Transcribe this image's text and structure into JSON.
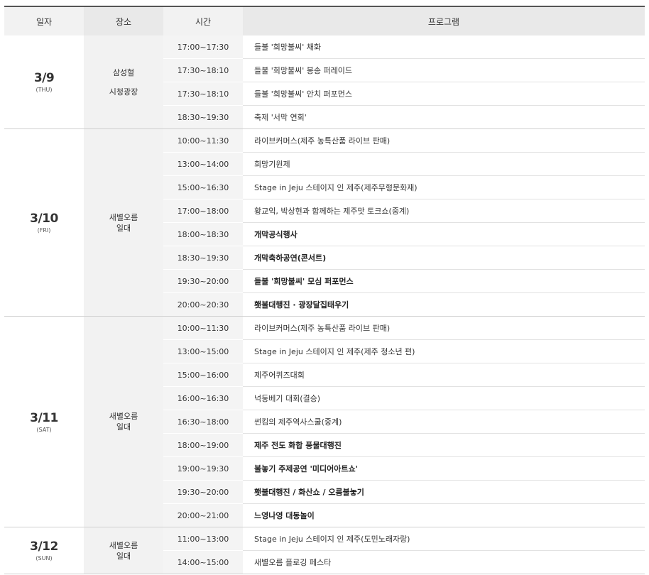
{
  "headers": {
    "date": "일자",
    "place": "장소",
    "time": "시간",
    "program": "프로그램"
  },
  "days": [
    {
      "date": "3/9",
      "weekday": "(THU)",
      "place_lines": [
        "삼성혈",
        "시청광장"
      ],
      "rows": [
        {
          "time": "17:00~17:30",
          "program": "들불 '희망불씨' 채화",
          "bold": false
        },
        {
          "time": "17:30~18:10",
          "program": "들불 '희망불씨' 봉송 퍼레이드",
          "bold": false
        },
        {
          "time": "17:30~18:10",
          "program": "들불 '희망불씨' 안치 퍼포먼스",
          "bold": false
        },
        {
          "time": "18:30~19:30",
          "program": "축제 '서막 연회'",
          "bold": false
        }
      ]
    },
    {
      "date": "3/10",
      "weekday": "(FRI)",
      "place_lines": [
        "새별오름",
        "일대"
      ],
      "rows": [
        {
          "time": "10:00~11:30",
          "program": "라이브커머스(제주 농특산품 라이브 판매)",
          "bold": false
        },
        {
          "time": "13:00~14:00",
          "program": "희망기원제",
          "bold": false
        },
        {
          "time": "15:00~16:30",
          "program": "Stage in Jeju 스테이지 인 제주(제주무형문화재)",
          "bold": false
        },
        {
          "time": "17:00~18:00",
          "program": "황교익, 박상현과 함께하는 제주맛 토크쇼(중계)",
          "bold": false
        },
        {
          "time": "18:00~18:30",
          "program": "개막공식행사",
          "bold": true
        },
        {
          "time": "18:30~19:30",
          "program": "개막축하공연(콘서트)",
          "bold": true
        },
        {
          "time": "19:30~20:00",
          "program": "들불 '희망불씨' 모심 퍼포먼스",
          "bold": true
        },
        {
          "time": "20:00~20:30",
          "program": "횃불대행진 · 광장달집태우기",
          "bold": true
        }
      ]
    },
    {
      "date": "3/11",
      "weekday": "(SAT)",
      "place_lines": [
        "새별오름",
        "일대"
      ],
      "rows": [
        {
          "time": "10:00~11:30",
          "program": "라이브커머스(제주 농특산품 라이브 판매)",
          "bold": false
        },
        {
          "time": "13:00~15:00",
          "program": "Stage in Jeju 스테이지 인 제주(제주 청소년 편)",
          "bold": false
        },
        {
          "time": "15:00~16:00",
          "program": "제주어퀴즈대회",
          "bold": false
        },
        {
          "time": "16:00~16:30",
          "program": "넉둥베기 대회(결승)",
          "bold": false
        },
        {
          "time": "16:30~18:00",
          "program": "썬킴의 제주역사스쿨(중계)",
          "bold": false
        },
        {
          "time": "18:00~19:00",
          "program": "제주 전도 화합 풍물대행진",
          "bold": true
        },
        {
          "time": "19:00~19:30",
          "program": "불놓기 주제공연 '미디어아트쇼'",
          "bold": true
        },
        {
          "time": "19:30~20:00",
          "program": "횃불대행진 / 화산쇼 / 오름불놓기",
          "bold": true
        },
        {
          "time": "20:00~21:00",
          "program": "느영나영 대동놀이",
          "bold": true
        }
      ]
    },
    {
      "date": "3/12",
      "weekday": "(SUN)",
      "place_lines": [
        "새별오름",
        "일대"
      ],
      "rows": [
        {
          "time": "11:00~13:00",
          "program": "Stage in Jeju 스테이지 인 제주(도민노래자랑)",
          "bold": false
        },
        {
          "time": "14:00~15:00",
          "program": "새별오름 플로깅 페스타",
          "bold": false
        }
      ]
    }
  ]
}
